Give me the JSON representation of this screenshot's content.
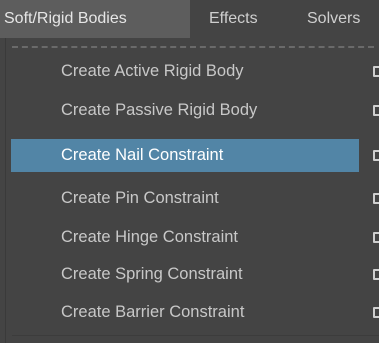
{
  "menubar": {
    "items": [
      {
        "label": "Soft/Rigid Bodies"
      },
      {
        "label": "Effects"
      },
      {
        "label": "Solvers"
      }
    ]
  },
  "dropdown": {
    "items": [
      {
        "label": "Create Active Rigid Body",
        "has_option_box": true
      },
      {
        "label": "Create Passive Rigid Body",
        "has_option_box": true
      },
      {
        "label": "Create Nail Constraint",
        "has_option_box": true,
        "highlighted": true
      },
      {
        "label": "Create Pin Constraint",
        "has_option_box": true
      },
      {
        "label": "Create Hinge Constraint",
        "has_option_box": true
      },
      {
        "label": "Create Spring Constraint",
        "has_option_box": true
      },
      {
        "label": "Create Barrier Constraint",
        "has_option_box": true
      }
    ]
  },
  "colors": {
    "background": "#444444",
    "highlight": "#5285a6",
    "active_menu": "#5d5d5d",
    "text": "#c8c8c8"
  }
}
